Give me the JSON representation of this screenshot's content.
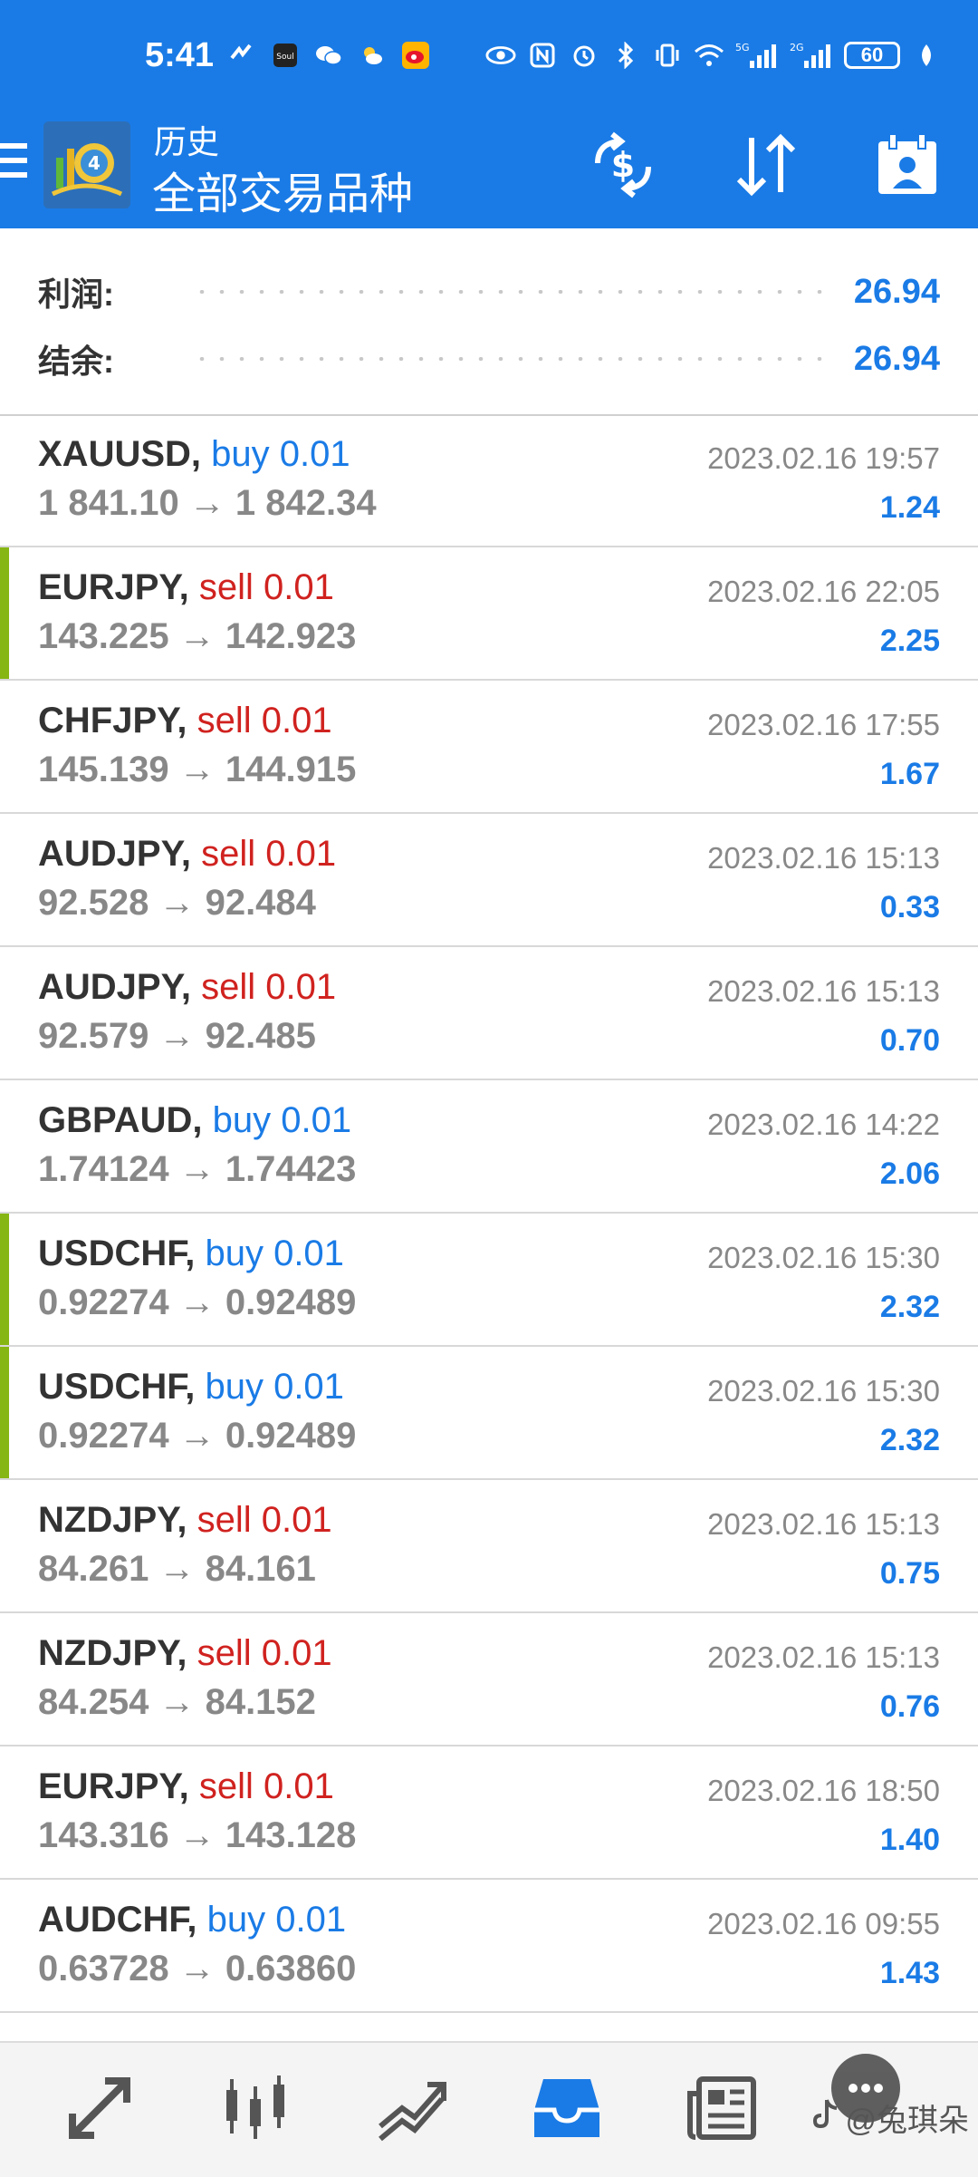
{
  "status_bar": {
    "time": "5:41",
    "battery": "60",
    "network_labels": [
      "5G",
      "2G"
    ]
  },
  "app_bar": {
    "title": "历史",
    "subtitle": "全部交易品种"
  },
  "summary": {
    "profit_label": "利润:",
    "profit_value": "26.94",
    "balance_label": "结余:",
    "balance_value": "26.94"
  },
  "trades": [
    {
      "symbol": "XAUUSD,",
      "side": "buy 0.01",
      "side_type": "buy",
      "prices": "1 841.10 → 1 842.34",
      "date": "2023.02.16 19:57",
      "profit": "1.24",
      "bar": false
    },
    {
      "symbol": "EURJPY,",
      "side": "sell 0.01",
      "side_type": "sell",
      "prices": "143.225 → 142.923",
      "date": "2023.02.16 22:05",
      "profit": "2.25",
      "bar": true
    },
    {
      "symbol": "CHFJPY,",
      "side": "sell 0.01",
      "side_type": "sell",
      "prices": "145.139 → 144.915",
      "date": "2023.02.16 17:55",
      "profit": "1.67",
      "bar": false
    },
    {
      "symbol": "AUDJPY,",
      "side": "sell 0.01",
      "side_type": "sell",
      "prices": "92.528 → 92.484",
      "date": "2023.02.16 15:13",
      "profit": "0.33",
      "bar": false
    },
    {
      "symbol": "AUDJPY,",
      "side": "sell 0.01",
      "side_type": "sell",
      "prices": "92.579 → 92.485",
      "date": "2023.02.16 15:13",
      "profit": "0.70",
      "bar": false
    },
    {
      "symbol": "GBPAUD,",
      "side": "buy 0.01",
      "side_type": "buy",
      "prices": "1.74124 → 1.74423",
      "date": "2023.02.16 14:22",
      "profit": "2.06",
      "bar": false
    },
    {
      "symbol": "USDCHF,",
      "side": "buy 0.01",
      "side_type": "buy",
      "prices": "0.92274 → 0.92489",
      "date": "2023.02.16 15:30",
      "profit": "2.32",
      "bar": true
    },
    {
      "symbol": "USDCHF,",
      "side": "buy 0.01",
      "side_type": "buy",
      "prices": "0.92274 → 0.92489",
      "date": "2023.02.16 15:30",
      "profit": "2.32",
      "bar": true
    },
    {
      "symbol": "NZDJPY,",
      "side": "sell 0.01",
      "side_type": "sell",
      "prices": "84.261 → 84.161",
      "date": "2023.02.16 15:13",
      "profit": "0.75",
      "bar": false
    },
    {
      "symbol": "NZDJPY,",
      "side": "sell 0.01",
      "side_type": "sell",
      "prices": "84.254 → 84.152",
      "date": "2023.02.16 15:13",
      "profit": "0.76",
      "bar": false
    },
    {
      "symbol": "EURJPY,",
      "side": "sell 0.01",
      "side_type": "sell",
      "prices": "143.316 → 143.128",
      "date": "2023.02.16 18:50",
      "profit": "1.40",
      "bar": false
    },
    {
      "symbol": "AUDCHF,",
      "side": "buy 0.01",
      "side_type": "buy",
      "prices": "0.63728 → 0.63860",
      "date": "2023.02.16 09:55",
      "profit": "1.43",
      "bar": false
    }
  ],
  "bottom_nav": [
    {
      "icon": "quotes-icon"
    },
    {
      "icon": "chart-icon"
    },
    {
      "icon": "trade-icon"
    },
    {
      "icon": "history-icon",
      "active": true
    },
    {
      "icon": "news-icon"
    },
    {
      "icon": "chat-icon"
    }
  ],
  "watermark": "@兔琪朵",
  "colors": {
    "primary": "#1a7be6",
    "sell": "#d0221f",
    "bar_green": "#86b614"
  }
}
